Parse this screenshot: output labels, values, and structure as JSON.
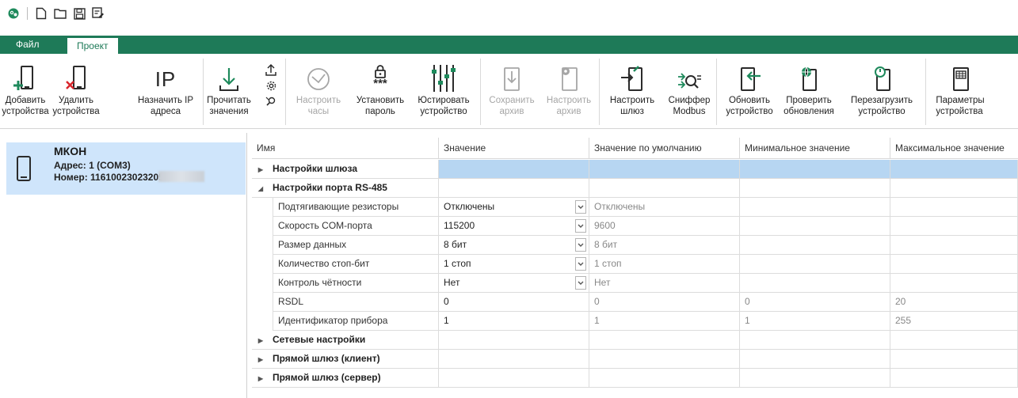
{
  "quick_access": {
    "icons": [
      "app-logo-icon",
      "new-file-icon",
      "open-folder-icon",
      "save-icon",
      "save-as-icon"
    ]
  },
  "tabs": [
    {
      "label": "Файл",
      "active": false
    },
    {
      "label": "Проект",
      "active": true
    }
  ],
  "ribbon": {
    "add_device": "Добавить\nустройства",
    "remove_device": "Удалить\nустройства",
    "assign_ip": "Назначить IP\nадреса",
    "read_values": "Прочитать\nзначения",
    "set_clock": "Настроить\nчасы",
    "set_password": "Установить\nпароль",
    "adjust_device": "Юстировать\nустройство",
    "save_archive": "Сохранить\nархив",
    "configure_archive": "Настроить\nархив",
    "configure_gateway": "Настроить\nшлюз",
    "modbus_sniffer": "Сниффер\nModbus",
    "update_device": "Обновить\nустройство",
    "check_updates": "Проверить\nобновления",
    "restart_device": "Перезагрузить\nустройство",
    "device_params": "Параметры\nустройства",
    "ip_glyph": "IP",
    "password_stars": "***"
  },
  "device": {
    "name": "МКОН",
    "address": "Адрес: 1 (COM3)",
    "number": "Номер: 11610023023205"
  },
  "grid": {
    "columns": [
      "Имя",
      "Значение",
      "Значение по умолчанию",
      "Минимальное значение",
      "Максимальное значение"
    ],
    "rows": [
      {
        "type": "group",
        "expanded": false,
        "name": "Настройки шлюза",
        "selected": true
      },
      {
        "type": "group",
        "expanded": true,
        "name": "Настройки порта RS-485"
      },
      {
        "type": "item",
        "name": "Подтягивающие резисторы",
        "value": "Отключены",
        "dropdown": true,
        "default": "Отключены",
        "min": "",
        "max": ""
      },
      {
        "type": "item",
        "name": "Скорость COM-порта",
        "value": "115200",
        "dropdown": true,
        "default": "9600",
        "min": "",
        "max": ""
      },
      {
        "type": "item",
        "name": "Размер данных",
        "value": "8 бит",
        "dropdown": true,
        "default": "8 бит",
        "min": "",
        "max": ""
      },
      {
        "type": "item",
        "name": "Количество стоп-бит",
        "value": "1 стоп",
        "dropdown": true,
        "default": "1 стоп",
        "min": "",
        "max": ""
      },
      {
        "type": "item",
        "name": "Контроль чётности",
        "value": "Нет",
        "dropdown": true,
        "default": "Нет",
        "min": "",
        "max": ""
      },
      {
        "type": "item",
        "name": "RSDL",
        "value": "0",
        "dropdown": false,
        "default": "0",
        "min": "0",
        "max": "20"
      },
      {
        "type": "item",
        "name": "Идентификатор прибора",
        "value": "1",
        "dropdown": false,
        "default": "1",
        "min": "1",
        "max": "255"
      },
      {
        "type": "group",
        "expanded": false,
        "name": "Сетевые настройки"
      },
      {
        "type": "group",
        "expanded": false,
        "name": "Прямой шлюз (клиент)"
      },
      {
        "type": "group",
        "expanded": false,
        "name": "Прямой шлюз (сервер)"
      }
    ]
  },
  "colors": {
    "accent": "#1e7a58",
    "selection": "#b7d6f2",
    "device_card": "#cfe5fb",
    "icon_dark": "#2b2b2b",
    "icon_green": "#1e8a5c",
    "icon_red": "#d9262c",
    "disabled": "#a6a6a6"
  }
}
